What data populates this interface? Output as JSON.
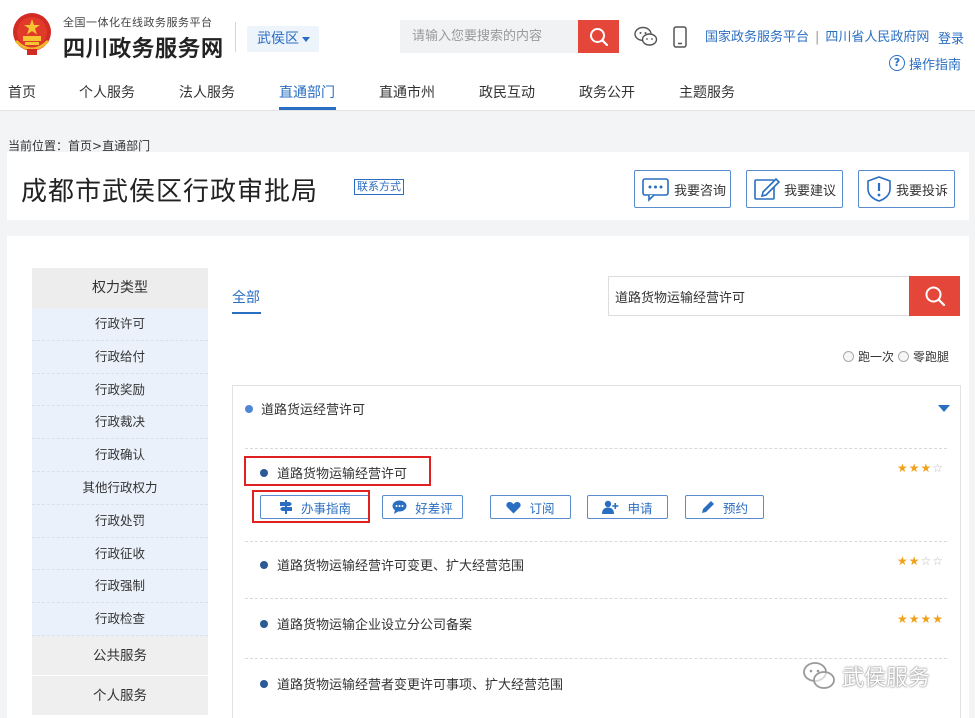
{
  "header": {
    "platform_small": "全国一体化在线政务服务平台",
    "platform_big": "四川政务服务网",
    "region": "武侯区",
    "search_placeholder": "请输入您要搜索的内容",
    "links": [
      "国家政务服务平台",
      "四川省人民政府网"
    ],
    "login": "登录",
    "guide": "操作指南"
  },
  "nav": [
    "首页",
    "个人服务",
    "法人服务",
    "直通部门",
    "直通市州",
    "政民互动",
    "政务公开",
    "主题服务"
  ],
  "nav_active": "直通部门",
  "breadcrumb": {
    "prefix": "当前位置：",
    "home": "首页",
    "sep": ">",
    "current": "直通部门"
  },
  "dept": {
    "title": "成都市武侯区行政审批局",
    "contact": "联系方式",
    "actions": [
      "我要咨询",
      "我要建议",
      "我要投诉"
    ]
  },
  "sidebar": {
    "head": "权力类型",
    "subs": [
      "行政许可",
      "行政给付",
      "行政奖励",
      "行政裁决",
      "行政确认",
      "其他行政权力",
      "行政处罚",
      "行政征收",
      "行政强制",
      "行政检查"
    ],
    "groups": [
      "公共服务",
      "个人服务"
    ]
  },
  "main": {
    "tab": "全部",
    "search_value": "道路货物运输经营许可",
    "radios": [
      "跑一次",
      "零跑腿"
    ],
    "group_title": "道路货运经营许可",
    "items": [
      {
        "title": "道路货物运输经营许可",
        "stars": 3
      },
      {
        "title": "道路货物运输经营许可变更、扩大经营范围",
        "stars": 2
      },
      {
        "title": "道路货物运输企业设立分公司备案",
        "stars": 4
      },
      {
        "title": "道路货物运输经营者变更许可事项、扩大经营范围",
        "stars": null
      }
    ],
    "actions": [
      "办事指南",
      "好差评",
      "订阅",
      "申请",
      "预约"
    ]
  },
  "watermark": "武侯服务",
  "colors": {
    "accent": "#2a6ec2",
    "search_red": "#e4473a",
    "highlight_red": "#e02121",
    "star": "#f0a21b"
  }
}
